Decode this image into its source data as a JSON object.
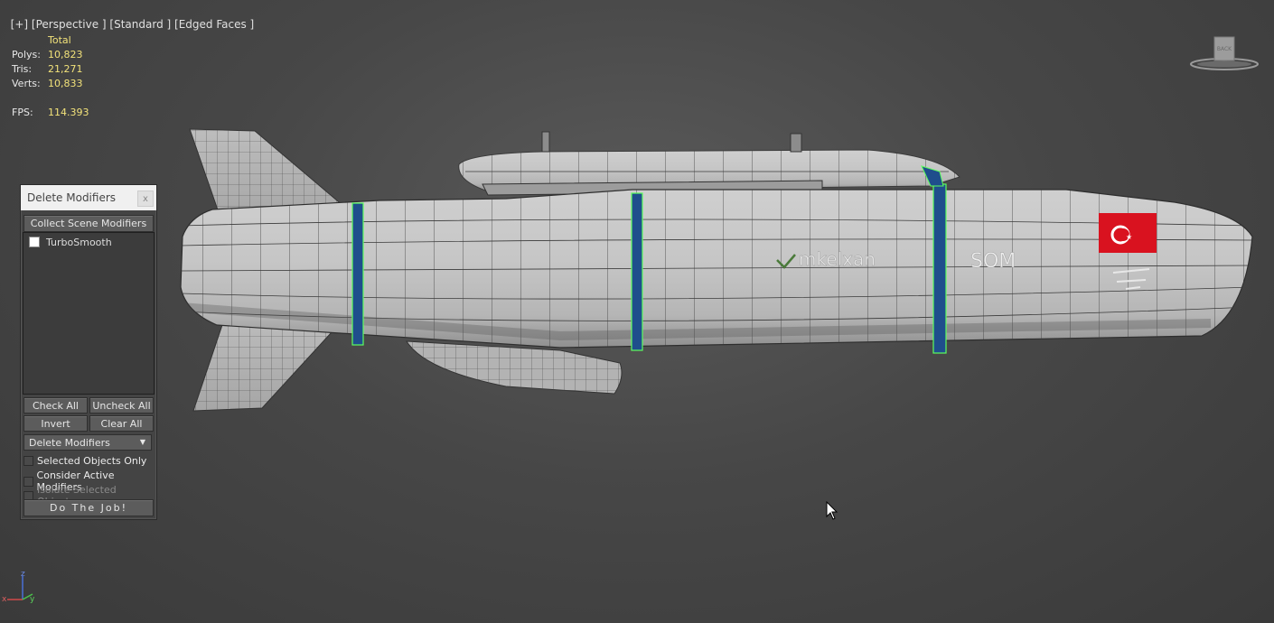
{
  "viewport": {
    "label_parts": [
      "[+]",
      "[Perspective ]",
      "[Standard ]",
      "[Edged Faces ]"
    ]
  },
  "stats": {
    "header": "Total",
    "rows": [
      {
        "label": "Polys:",
        "value": "10,823"
      },
      {
        "label": "Tris:",
        "value": "21,271"
      },
      {
        "label": "Verts:",
        "value": "10,833"
      }
    ],
    "fps_label": "FPS:",
    "fps_value": "114.393"
  },
  "viewcube": {
    "face_label": "BACK"
  },
  "model_markings": {
    "brand_text": "mkelxan",
    "model_text": "SOM"
  },
  "dialog": {
    "title": "Delete Modifiers",
    "close_label": "x",
    "collect_button": "Collect Scene Modifiers",
    "list_items": [
      {
        "label": "TurboSmooth",
        "checked": false
      }
    ],
    "check_all": "Check All",
    "uncheck_all": "Uncheck All",
    "invert": "Invert",
    "clear_all": "Clear All",
    "mode_select": "Delete Modifiers",
    "options": {
      "selected_only": "Selected Objects Only",
      "consider_active": "Consider Active Modifiers",
      "isolate_selected": "Isolate Selected Objects"
    },
    "do_job": "Do The Job!"
  },
  "axis": {
    "z": "z",
    "x": "x",
    "y": "y"
  },
  "colors": {
    "background": "#474747",
    "stats_value": "#f2e27a",
    "selection_band": "#1f4e8c",
    "selection_edge": "#5dff5d",
    "flag_red": "#d9121f"
  }
}
